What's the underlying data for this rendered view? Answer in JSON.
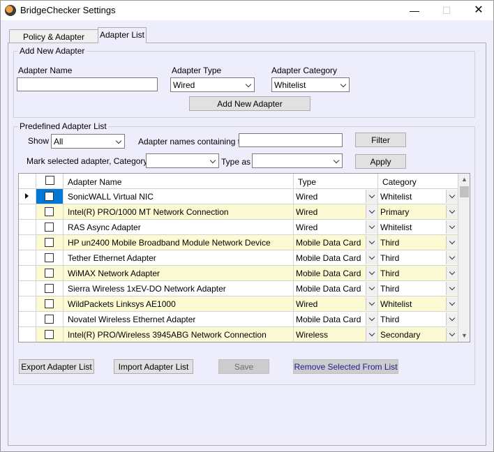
{
  "window": {
    "title": "BridgeChecker Settings",
    "min": "—",
    "max": "☐",
    "close": "✕"
  },
  "tabs": [
    {
      "label": "Policy & Adapter Settings"
    },
    {
      "label": "Adapter List"
    }
  ],
  "add_new": {
    "title": "Add New Adapter",
    "name_label": "Adapter Name",
    "name_value": "",
    "type_label": "Adapter Type",
    "type_value": "Wired",
    "category_label": "Adapter Category",
    "category_value": "Whitelist",
    "button": "Add New Adapter"
  },
  "predefined": {
    "title": "Predefined Adapter List",
    "show_label": "Show",
    "show_value": "All",
    "contains_label": "Adapter names containing text",
    "contains_value": "",
    "filter_button": "Filter",
    "mark_label": "Mark selected adapter, Category as",
    "mark_category_value": "",
    "type_as_label": "Type as",
    "type_as_value": "",
    "apply_button": "Apply"
  },
  "grid": {
    "columns": [
      "Adapter Name",
      "Type",
      "Category"
    ],
    "rows": [
      {
        "name": "SonicWALL Virtual NIC",
        "type": "Wired",
        "category": "Whitelist"
      },
      {
        "name": "Intel(R) PRO/1000 MT Network Connection",
        "type": "Wired",
        "category": "Primary"
      },
      {
        "name": "RAS Async Adapter",
        "type": "Wired",
        "category": "Whitelist"
      },
      {
        "name": "HP un2400 Mobile Broadband Module Network Device",
        "type": "Mobile Data Card",
        "category": "Third"
      },
      {
        "name": "Tether Ethernet Adapter",
        "type": "Mobile Data Card",
        "category": "Third"
      },
      {
        "name": "WiMAX Network Adapter",
        "type": "Mobile Data Card",
        "category": "Third"
      },
      {
        "name": "Sierra Wireless 1xEV-DO Network Adapter",
        "type": "Mobile Data Card",
        "category": "Third"
      },
      {
        "name": "WildPackets Linksys AE1000",
        "type": "Wired",
        "category": "Whitelist"
      },
      {
        "name": "Novatel Wireless Ethernet Adapter",
        "type": "Mobile Data Card",
        "category": "Third"
      },
      {
        "name": "Intel(R) PRO/Wireless 3945ABG Network Connection",
        "type": "Wireless",
        "category": "Secondary"
      }
    ]
  },
  "buttons": {
    "export": "Export Adapter List",
    "import": "Import Adapter List",
    "save": "Save",
    "remove": "Remove Selected From List"
  },
  "colors": {
    "background": "#ededfb",
    "alt_row": "#fcfad2",
    "selection": "#0078d7"
  }
}
